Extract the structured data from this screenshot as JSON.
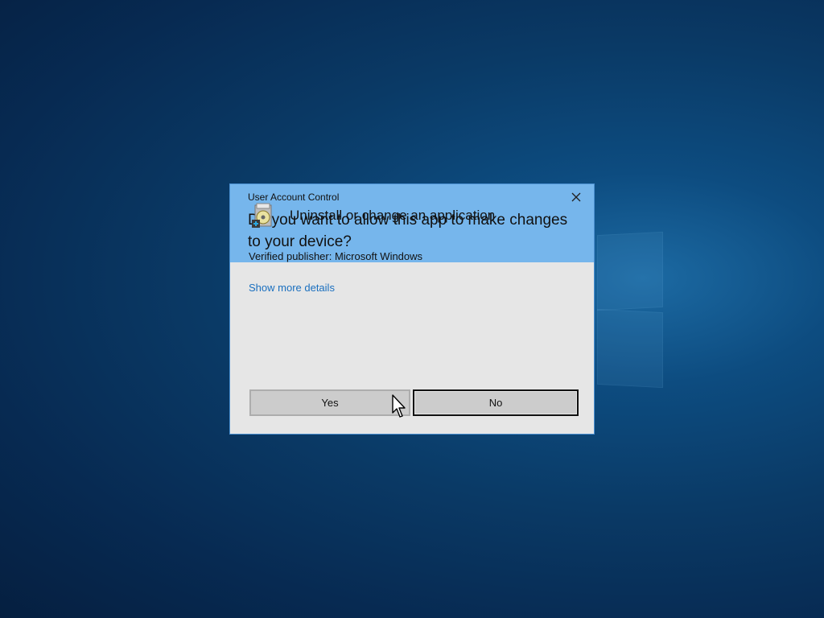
{
  "dialog": {
    "window_title": "User Account Control",
    "question": "Do you want to allow this app to make changes to your device?",
    "app_name": "Uninstall or change an application",
    "app_icon": "installer-disc-icon",
    "publisher": "Verified publisher: Microsoft Windows",
    "details_link": "Show more details",
    "yes_label": "Yes",
    "no_label": "No",
    "header_color": "#76b6ec",
    "body_color": "#e6e6e6",
    "link_color": "#1a6fbf"
  }
}
